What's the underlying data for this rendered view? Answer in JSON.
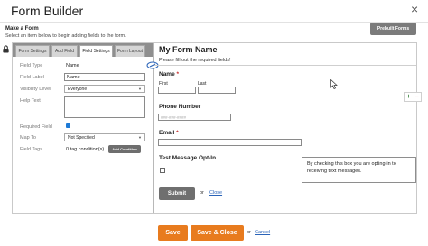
{
  "header": {
    "title": "Form Builder",
    "close_glyph": "×",
    "make_form": "Make a Form",
    "select_help": "Select an item below to begin adding fields to the form.",
    "prebuilt_label": "Prebuilt Forms"
  },
  "tabs": [
    {
      "label": "Form Settings",
      "active": false
    },
    {
      "label": "Add Field",
      "active": false
    },
    {
      "label": "Field Settings",
      "active": true
    },
    {
      "label": "Form Layout",
      "active": false
    }
  ],
  "field_settings": {
    "field_type_label": "Field Type",
    "field_type_value": "Name",
    "field_label_label": "Field Label",
    "field_label_value": "Name",
    "visibility_label": "Visibility Level",
    "visibility_value": "Everyone",
    "help_text_label": "Help Text",
    "help_text_value": "",
    "required_label": "Required Field",
    "required_checked": true,
    "map_to_label": "Map To",
    "map_to_value": "Not Specified",
    "field_tags_label": "Field Tags",
    "field_tags_value": "0 tag condition(s)",
    "add_condition_label": "Add Condition"
  },
  "form": {
    "title": "My Form Name",
    "hint": "Please fill out the required fields!",
    "name_label": "Name",
    "required_mark": "*",
    "first_label": "First",
    "last_label": "Last",
    "phone_label": "Phone Number",
    "phone_placeholder": "###-###-####",
    "email_label": "Email",
    "sms_label": "Test Message Opt-In",
    "sms_help": "By checking this box you are opting-in to receiving text messages.",
    "submit_label": "Submit",
    "or_text": "or",
    "close_label": "Close"
  },
  "side_controls": {
    "plus": "+",
    "minus": "−"
  },
  "footer": {
    "save_label": "Save",
    "save_close_label": "Save & Close",
    "or_text": "or",
    "cancel_label": "Cancel"
  },
  "colors": {
    "accent": "#e87b1e",
    "link": "#2a63b8",
    "checkbox": "#1e7ad6"
  }
}
